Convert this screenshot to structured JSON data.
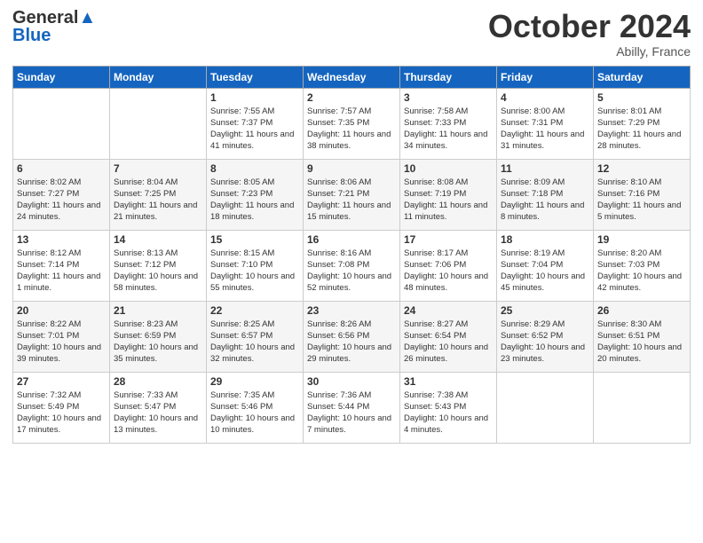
{
  "logo": {
    "text_general": "General",
    "text_blue": "Blue"
  },
  "header": {
    "month_year": "October 2024",
    "location": "Abilly, France"
  },
  "weekdays": [
    "Sunday",
    "Monday",
    "Tuesday",
    "Wednesday",
    "Thursday",
    "Friday",
    "Saturday"
  ],
  "weeks": [
    [
      {
        "day": "",
        "sunrise": "",
        "sunset": "",
        "daylight": ""
      },
      {
        "day": "",
        "sunrise": "",
        "sunset": "",
        "daylight": ""
      },
      {
        "day": "1",
        "sunrise": "Sunrise: 7:55 AM",
        "sunset": "Sunset: 7:37 PM",
        "daylight": "Daylight: 11 hours and 41 minutes."
      },
      {
        "day": "2",
        "sunrise": "Sunrise: 7:57 AM",
        "sunset": "Sunset: 7:35 PM",
        "daylight": "Daylight: 11 hours and 38 minutes."
      },
      {
        "day": "3",
        "sunrise": "Sunrise: 7:58 AM",
        "sunset": "Sunset: 7:33 PM",
        "daylight": "Daylight: 11 hours and 34 minutes."
      },
      {
        "day": "4",
        "sunrise": "Sunrise: 8:00 AM",
        "sunset": "Sunset: 7:31 PM",
        "daylight": "Daylight: 11 hours and 31 minutes."
      },
      {
        "day": "5",
        "sunrise": "Sunrise: 8:01 AM",
        "sunset": "Sunset: 7:29 PM",
        "daylight": "Daylight: 11 hours and 28 minutes."
      }
    ],
    [
      {
        "day": "6",
        "sunrise": "Sunrise: 8:02 AM",
        "sunset": "Sunset: 7:27 PM",
        "daylight": "Daylight: 11 hours and 24 minutes."
      },
      {
        "day": "7",
        "sunrise": "Sunrise: 8:04 AM",
        "sunset": "Sunset: 7:25 PM",
        "daylight": "Daylight: 11 hours and 21 minutes."
      },
      {
        "day": "8",
        "sunrise": "Sunrise: 8:05 AM",
        "sunset": "Sunset: 7:23 PM",
        "daylight": "Daylight: 11 hours and 18 minutes."
      },
      {
        "day": "9",
        "sunrise": "Sunrise: 8:06 AM",
        "sunset": "Sunset: 7:21 PM",
        "daylight": "Daylight: 11 hours and 15 minutes."
      },
      {
        "day": "10",
        "sunrise": "Sunrise: 8:08 AM",
        "sunset": "Sunset: 7:19 PM",
        "daylight": "Daylight: 11 hours and 11 minutes."
      },
      {
        "day": "11",
        "sunrise": "Sunrise: 8:09 AM",
        "sunset": "Sunset: 7:18 PM",
        "daylight": "Daylight: 11 hours and 8 minutes."
      },
      {
        "day": "12",
        "sunrise": "Sunrise: 8:10 AM",
        "sunset": "Sunset: 7:16 PM",
        "daylight": "Daylight: 11 hours and 5 minutes."
      }
    ],
    [
      {
        "day": "13",
        "sunrise": "Sunrise: 8:12 AM",
        "sunset": "Sunset: 7:14 PM",
        "daylight": "Daylight: 11 hours and 1 minute."
      },
      {
        "day": "14",
        "sunrise": "Sunrise: 8:13 AM",
        "sunset": "Sunset: 7:12 PM",
        "daylight": "Daylight: 10 hours and 58 minutes."
      },
      {
        "day": "15",
        "sunrise": "Sunrise: 8:15 AM",
        "sunset": "Sunset: 7:10 PM",
        "daylight": "Daylight: 10 hours and 55 minutes."
      },
      {
        "day": "16",
        "sunrise": "Sunrise: 8:16 AM",
        "sunset": "Sunset: 7:08 PM",
        "daylight": "Daylight: 10 hours and 52 minutes."
      },
      {
        "day": "17",
        "sunrise": "Sunrise: 8:17 AM",
        "sunset": "Sunset: 7:06 PM",
        "daylight": "Daylight: 10 hours and 48 minutes."
      },
      {
        "day": "18",
        "sunrise": "Sunrise: 8:19 AM",
        "sunset": "Sunset: 7:04 PM",
        "daylight": "Daylight: 10 hours and 45 minutes."
      },
      {
        "day": "19",
        "sunrise": "Sunrise: 8:20 AM",
        "sunset": "Sunset: 7:03 PM",
        "daylight": "Daylight: 10 hours and 42 minutes."
      }
    ],
    [
      {
        "day": "20",
        "sunrise": "Sunrise: 8:22 AM",
        "sunset": "Sunset: 7:01 PM",
        "daylight": "Daylight: 10 hours and 39 minutes."
      },
      {
        "day": "21",
        "sunrise": "Sunrise: 8:23 AM",
        "sunset": "Sunset: 6:59 PM",
        "daylight": "Daylight: 10 hours and 35 minutes."
      },
      {
        "day": "22",
        "sunrise": "Sunrise: 8:25 AM",
        "sunset": "Sunset: 6:57 PM",
        "daylight": "Daylight: 10 hours and 32 minutes."
      },
      {
        "day": "23",
        "sunrise": "Sunrise: 8:26 AM",
        "sunset": "Sunset: 6:56 PM",
        "daylight": "Daylight: 10 hours and 29 minutes."
      },
      {
        "day": "24",
        "sunrise": "Sunrise: 8:27 AM",
        "sunset": "Sunset: 6:54 PM",
        "daylight": "Daylight: 10 hours and 26 minutes."
      },
      {
        "day": "25",
        "sunrise": "Sunrise: 8:29 AM",
        "sunset": "Sunset: 6:52 PM",
        "daylight": "Daylight: 10 hours and 23 minutes."
      },
      {
        "day": "26",
        "sunrise": "Sunrise: 8:30 AM",
        "sunset": "Sunset: 6:51 PM",
        "daylight": "Daylight: 10 hours and 20 minutes."
      }
    ],
    [
      {
        "day": "27",
        "sunrise": "Sunrise: 7:32 AM",
        "sunset": "Sunset: 5:49 PM",
        "daylight": "Daylight: 10 hours and 17 minutes."
      },
      {
        "day": "28",
        "sunrise": "Sunrise: 7:33 AM",
        "sunset": "Sunset: 5:47 PM",
        "daylight": "Daylight: 10 hours and 13 minutes."
      },
      {
        "day": "29",
        "sunrise": "Sunrise: 7:35 AM",
        "sunset": "Sunset: 5:46 PM",
        "daylight": "Daylight: 10 hours and 10 minutes."
      },
      {
        "day": "30",
        "sunrise": "Sunrise: 7:36 AM",
        "sunset": "Sunset: 5:44 PM",
        "daylight": "Daylight: 10 hours and 7 minutes."
      },
      {
        "day": "31",
        "sunrise": "Sunrise: 7:38 AM",
        "sunset": "Sunset: 5:43 PM",
        "daylight": "Daylight: 10 hours and 4 minutes."
      },
      {
        "day": "",
        "sunrise": "",
        "sunset": "",
        "daylight": ""
      },
      {
        "day": "",
        "sunrise": "",
        "sunset": "",
        "daylight": ""
      }
    ]
  ]
}
